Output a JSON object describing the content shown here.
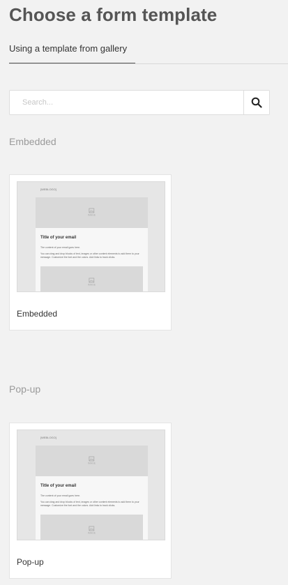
{
  "page": {
    "title": "Choose a form template",
    "tab_label": "Using a template from gallery"
  },
  "search": {
    "placeholder": "Search...",
    "value": ""
  },
  "sections": [
    {
      "label": "Embedded",
      "card": {
        "name": "Embedded",
        "preview": {
          "logo": "[WEBLOGO]",
          "image_label": "IMAGE",
          "title": "Title of your email",
          "line1": "The content of your email goes here.",
          "line2": "You can drag and drop blocks of text, images or other content elements to add them to your message. Customize the font and the colors. Add links to track clicks."
        }
      }
    },
    {
      "label": "Pop-up",
      "card": {
        "name": "Pop-up",
        "preview": {
          "logo": "[WEBLOGO]",
          "image_label": "IMAGE",
          "title": "Title of your email",
          "line1": "The content of your email goes here.",
          "line2": "You can drag and drop blocks of text, images or other content elements to add them to your message. Customize the font and the colors. Add links to track clicks."
        }
      }
    }
  ],
  "icons": {
    "search": "search-icon",
    "image": "image-icon"
  },
  "colors": {
    "background": "#f2f2f2",
    "title": "#555555",
    "section_label": "#9a9a9a"
  }
}
